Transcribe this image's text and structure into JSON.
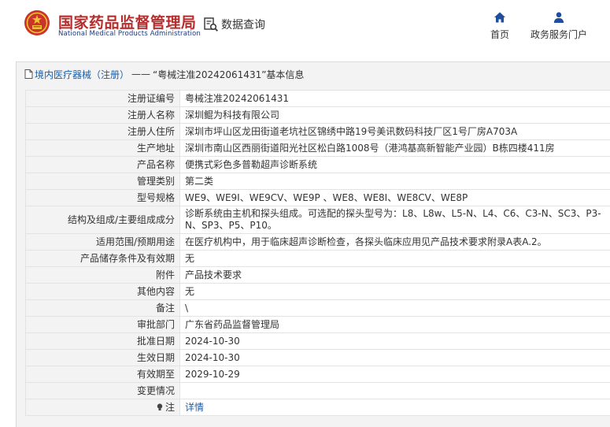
{
  "header": {
    "brand_cn": "国家药品监督管理局",
    "brand_en": "National Medical Products Administration",
    "query_label": "数据查询",
    "nav_home": "首页",
    "nav_service": "政务服务门户"
  },
  "panel": {
    "category_link": "境内医疗器械（注册）",
    "separator": "——",
    "title_rest": "“粤械注准20242061431”基本信息"
  },
  "rows": [
    {
      "label": "注册证编号",
      "value": "粤械注准20242061431"
    },
    {
      "label": "注册人名称",
      "value": "深圳鲲为科技有限公司"
    },
    {
      "label": "注册人住所",
      "value": "深圳市坪山区龙田街道老坑社区锦绣中路19号美讯数码科技厂区1号厂房A703A"
    },
    {
      "label": "生产地址",
      "value": "深圳市南山区西丽街道阳光社区松白路1008号（港鸿基高新智能产业园）B栋四楼411房"
    },
    {
      "label": "产品名称",
      "value": "便携式彩色多普勒超声诊断系统"
    },
    {
      "label": "管理类别",
      "value": "第二类"
    },
    {
      "label": "型号规格",
      "value": "WE9、WE9I、WE9CV、WE9P 、WE8、WE8I、WE8CV、WE8P"
    },
    {
      "label": "结构及组成/主要组成成分",
      "value": "诊断系统由主机和探头组成。可选配的探头型号为：L8、L8w、L5-N、L4、C6、C3-N、SC3、P3-N、SP3、P5、P10。"
    },
    {
      "label": "适用范围/预期用途",
      "value": "在医疗机构中，用于临床超声诊断检查，各探头临床应用见产品技术要求附录A表A.2。"
    },
    {
      "label": "产品储存条件及有效期",
      "value": "无"
    },
    {
      "label": "附件",
      "value": "产品技术要求"
    },
    {
      "label": "其他内容",
      "value": "无"
    },
    {
      "label": "备注",
      "value": "\\"
    },
    {
      "label": "审批部门",
      "value": "广东省药品监督管理局"
    },
    {
      "label": "批准日期",
      "value": "2024-10-30"
    },
    {
      "label": "生效日期",
      "value": "2024-10-30"
    },
    {
      "label": "有效期至",
      "value": "2029-10-29"
    },
    {
      "label": "变更情况",
      "value": ""
    }
  ],
  "note": {
    "label": "注",
    "link": "详情"
  },
  "colors": {
    "brand_red": "#b62d2d",
    "brand_blue": "#1f3b7a",
    "link_blue": "#1b5ea8"
  }
}
